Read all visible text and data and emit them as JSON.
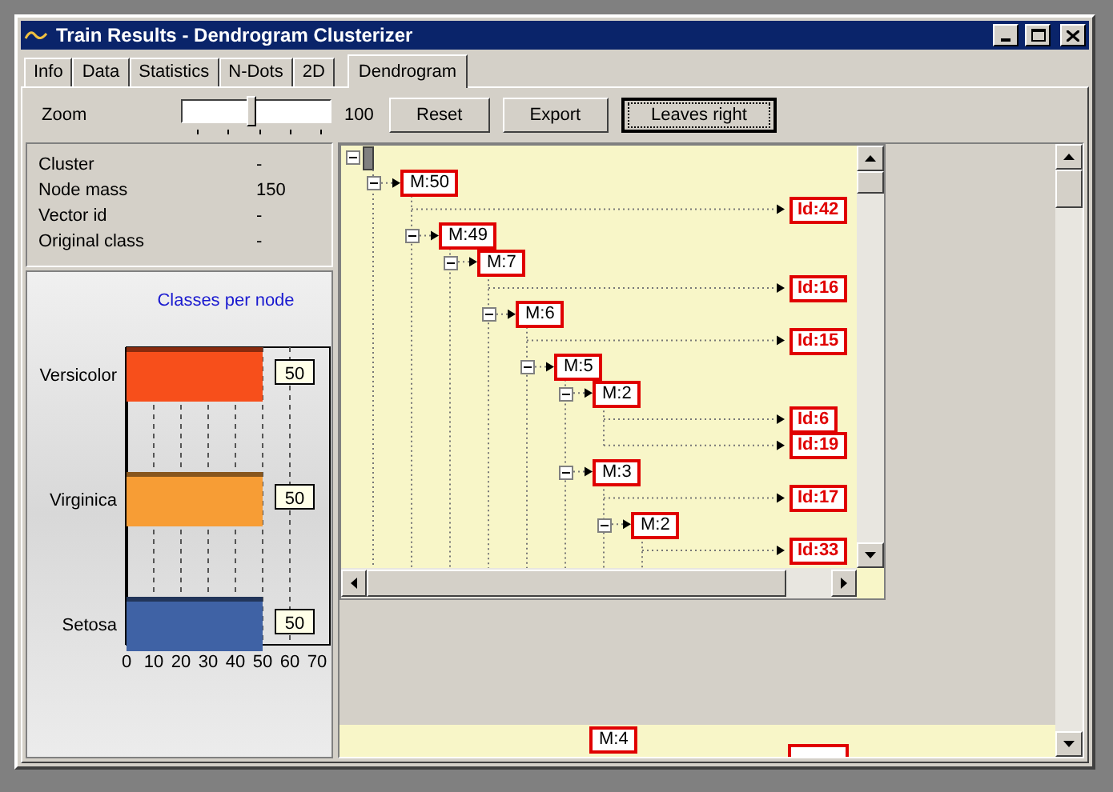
{
  "window": {
    "title": "Train Results - Dendrogram Clusterizer"
  },
  "tabs": [
    {
      "label": "Info",
      "selected": false
    },
    {
      "label": "Data",
      "selected": false
    },
    {
      "label": "Statistics",
      "selected": false
    },
    {
      "label": "N-Dots",
      "selected": false
    },
    {
      "label": "2D",
      "selected": false
    },
    {
      "label": "Dendrogram",
      "selected": true
    }
  ],
  "toolbar": {
    "zoom_label": "Zoom",
    "zoom_slider": {
      "level": 0.47
    },
    "zoom_value": "100",
    "buttons": [
      {
        "label": "Reset",
        "focused": false
      },
      {
        "label": "Export",
        "focused": false
      },
      {
        "label": "Leaves right",
        "focused": true
      }
    ]
  },
  "node_info": [
    {
      "label": "Cluster",
      "value": "-"
    },
    {
      "label": "Node mass",
      "value": "150"
    },
    {
      "label": "Vector id",
      "value": "-"
    },
    {
      "label": "Original class",
      "value": "-"
    }
  ],
  "chart": {
    "chart_data": {
      "type": "bar",
      "orientation": "horizontal",
      "title": "Classes per node",
      "series": [
        {
          "name": "Versicolor",
          "color": "#f74f1b",
          "values": [
            50
          ]
        },
        {
          "name": "Virginica",
          "color": "#f79d35",
          "values": [
            50
          ]
        },
        {
          "name": "Setosa",
          "color": "#3f62a5",
          "values": [
            50
          ]
        }
      ],
      "xlim": [
        0,
        70
      ],
      "xticks": [
        0,
        10,
        20,
        30,
        40,
        50,
        60,
        70
      ],
      "grid": true,
      "data_labels": true
    }
  },
  "tree": {
    "kind": "root",
    "expanded": true,
    "children": [
      {
        "label": "M:50",
        "kind": "cluster",
        "expanded": true,
        "children": [
          {
            "label": "Id:42",
            "kind": "leaf"
          },
          {
            "label": "M:49",
            "kind": "cluster",
            "expanded": true,
            "children": [
              {
                "label": "M:7",
                "kind": "cluster",
                "expanded": true,
                "children": [
                  {
                    "label": "Id:16",
                    "kind": "leaf"
                  },
                  {
                    "label": "M:6",
                    "kind": "cluster",
                    "expanded": true,
                    "children": [
                      {
                        "label": "Id:15",
                        "kind": "leaf"
                      },
                      {
                        "label": "M:5",
                        "kind": "cluster",
                        "expanded": true,
                        "children": [
                          {
                            "label": "M:2",
                            "kind": "cluster",
                            "expanded": true,
                            "children": [
                              {
                                "label": "Id:6",
                                "kind": "leaf"
                              },
                              {
                                "label": "Id:19",
                                "kind": "leaf"
                              }
                            ]
                          },
                          {
                            "label": "M:3",
                            "kind": "cluster",
                            "expanded": true,
                            "children": [
                              {
                                "label": "Id:17",
                                "kind": "leaf"
                              },
                              {
                                "label": "M:2",
                                "kind": "cluster",
                                "expanded": true,
                                "children": [
                                  {
                                    "label": "Id:33",
                                    "kind": "leaf"
                                  }
                                ]
                              }
                            ]
                          }
                        ]
                      }
                    ]
                  }
                ]
              }
            ]
          }
        ]
      }
    ]
  },
  "lower_pane": {
    "partial_node": "M:4"
  }
}
